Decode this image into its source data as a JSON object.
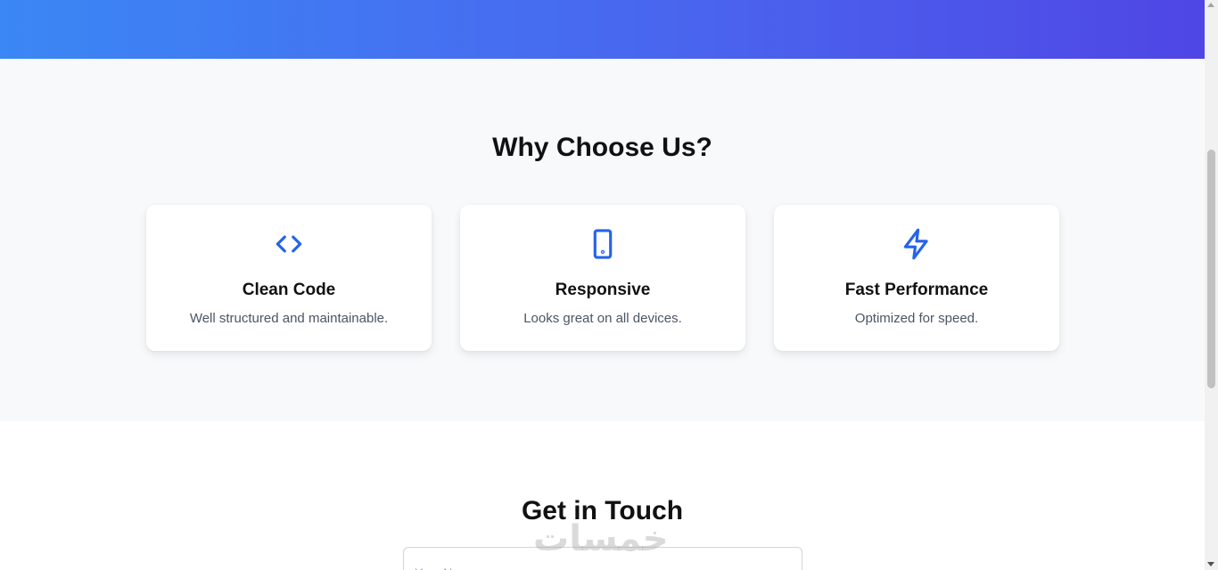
{
  "features": {
    "title": "Why Choose Us?",
    "cards": [
      {
        "icon": "code-icon",
        "title": "Clean Code",
        "description": "Well structured and maintainable."
      },
      {
        "icon": "mobile-device-icon",
        "title": "Responsive",
        "description": "Looks great on all devices."
      },
      {
        "icon": "lightning-bolt-icon",
        "title": "Fast Performance",
        "description": "Optimized for speed."
      }
    ]
  },
  "contact": {
    "title": "Get in Touch",
    "name_placeholder": "Your Name"
  },
  "watermark": {
    "text": "خمسات"
  },
  "colors": {
    "accent": "#2563eb",
    "gradient_start": "#3b87f5",
    "gradient_end": "#4f46e5",
    "section_bg": "#f8f9fb"
  }
}
